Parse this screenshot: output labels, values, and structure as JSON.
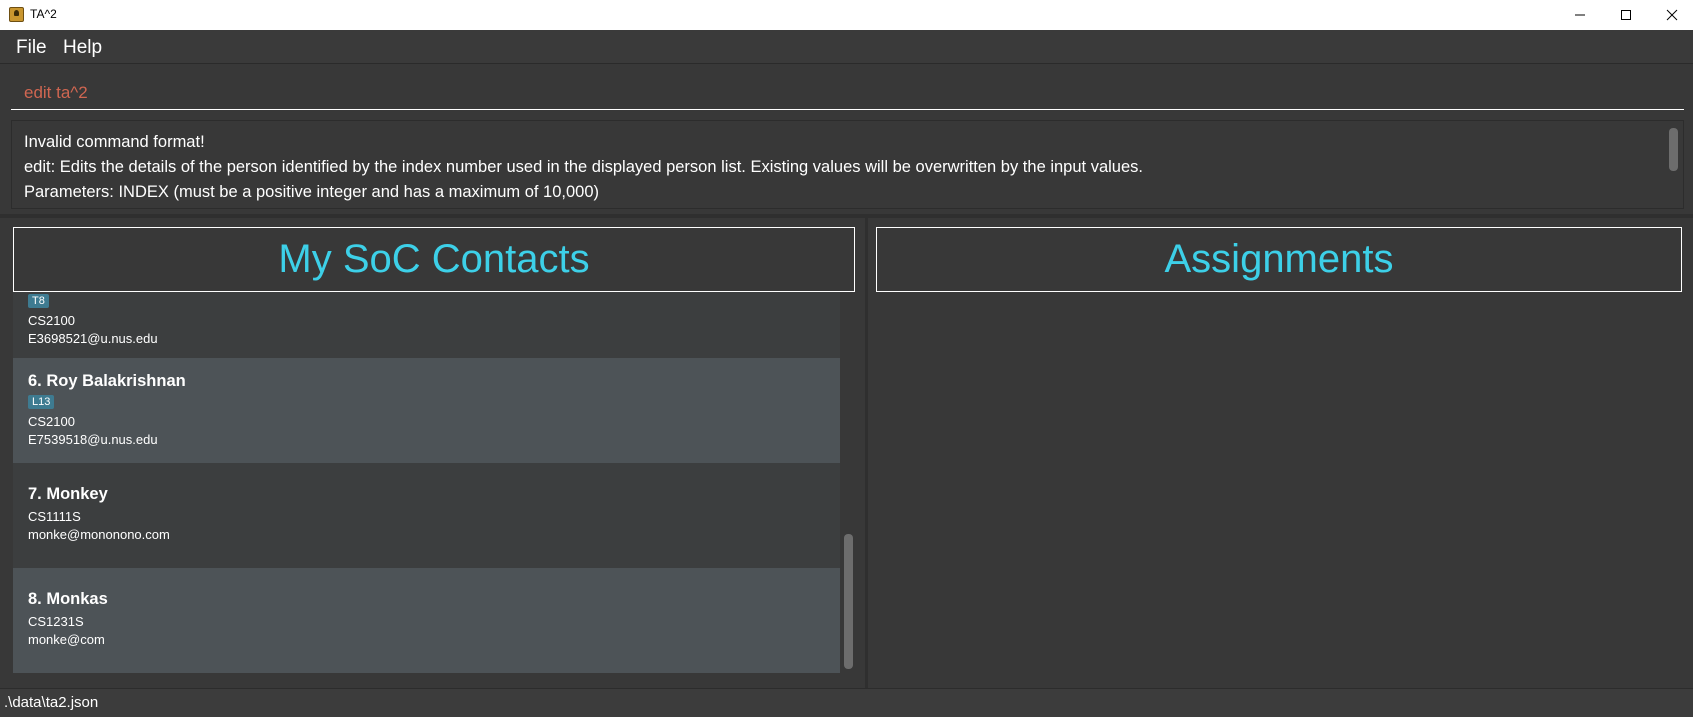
{
  "window": {
    "title": "TA^2",
    "minimize_icon": "minimize-icon",
    "maximize_icon": "maximize-icon",
    "close_icon": "close-icon"
  },
  "menu": {
    "items": [
      {
        "label": "File"
      },
      {
        "label": "Help"
      }
    ]
  },
  "command": {
    "value": "edit ta^2"
  },
  "result": {
    "lines": [
      "Invalid command format!",
      "edit: Edits the details of the person identified by the index number used in the displayed person list. Existing values will be overwritten by the input values.",
      "Parameters: INDEX (must be a positive integer and has a maximum of 10,000)"
    ]
  },
  "contacts_panel": {
    "title": "My SoC Contacts",
    "cards": [
      {
        "name": "",
        "tag": "T8",
        "module": "CS2100",
        "email": "E3698521@u.nus.edu"
      },
      {
        "name": "6.  Roy Balakrishnan",
        "tag": "L13",
        "module": "CS2100",
        "email": "E7539518@u.nus.edu"
      },
      {
        "name": "7.  Monkey",
        "tag": "",
        "module": "CS1111S",
        "email": "monke@mononono.com"
      },
      {
        "name": "8.  Monkas",
        "tag": "",
        "module": "CS1231S",
        "email": "monke@com"
      }
    ]
  },
  "assignments_panel": {
    "title": "Assignments"
  },
  "status": {
    "file_path": ".\\data\\ta2.json"
  },
  "colors": {
    "accent": "#3dd0e8",
    "command_text": "#d06651",
    "tag": "#3e7b91",
    "card_light": "#4d5357",
    "card_dark": "#3c3e3f"
  }
}
